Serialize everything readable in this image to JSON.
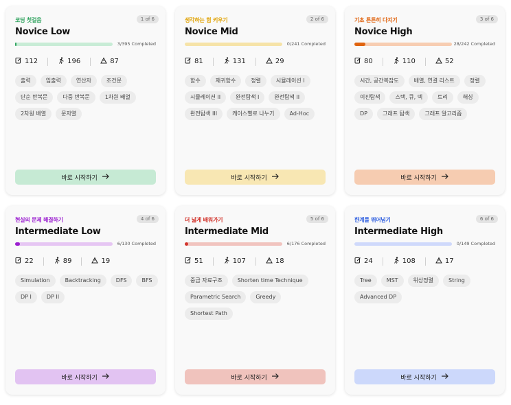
{
  "cards": [
    {
      "subtitle": "코딩 첫걸음",
      "subtitle_color": "#2fa25e",
      "stage": "1 of 6",
      "title": "Novice Low",
      "progress_text": "3/395 Completed",
      "progress_fraction": 0.0076,
      "track_color": "#c8ecd6",
      "fill_color": "#2fa25e",
      "stats": {
        "problems": "112",
        "solvers": "196",
        "levels": "87"
      },
      "tags": [
        "출력",
        "입출력",
        "연산자",
        "조건문",
        "단순 반복문",
        "다중 반복문",
        "1차원 배열",
        "2차원 배열",
        "문자열"
      ],
      "button_label": "바로 시작하기",
      "button_color": "#c6ead4"
    },
    {
      "subtitle": "생각하는 힘 키우기",
      "subtitle_color": "#e0a100",
      "stage": "2 of 6",
      "title": "Novice Mid",
      "progress_text": "0/241 Completed",
      "progress_fraction": 0,
      "track_color": "#f6e3a8",
      "fill_color": "#e0a100",
      "stats": {
        "problems": "81",
        "solvers": "131",
        "levels": "29"
      },
      "tags": [
        "함수",
        "재귀함수",
        "정렬",
        "시뮬레이션 I",
        "시뮬레이션 II",
        "완전탐색 I",
        "완전탐색 II",
        "완전탐색 III",
        "케이스별로 나누기",
        "Ad-Hoc"
      ],
      "button_label": "바로 시작하기",
      "button_color": "#f8e7b3"
    },
    {
      "subtitle": "기초 튼튼히 다지기",
      "subtitle_color": "#e06410",
      "stage": "3 of 6",
      "title": "Novice High",
      "progress_text": "28/242 Completed",
      "progress_fraction": 0.1157,
      "track_color": "#f7cdb2",
      "fill_color": "#e06410",
      "stats": {
        "problems": "80",
        "solvers": "110",
        "levels": "52"
      },
      "tags": [
        "시간, 공간복잡도",
        "배열, 연결 리스트",
        "정렬",
        "이진탐색",
        "스택, 큐, 덱",
        "트리",
        "해싱",
        "DP",
        "그래프 탐색",
        "그래프 알고리즘"
      ],
      "button_label": "바로 시작하기",
      "button_color": "#f6ccb1"
    },
    {
      "subtitle": "현실의 문제 해결하기",
      "subtitle_color": "#9b1fd0",
      "stage": "4 of 6",
      "title": "Intermediate Low",
      "progress_text": "6/130 Completed",
      "progress_fraction": 0.046,
      "track_color": "#e6c6f3",
      "fill_color": "#9b1fd0",
      "stats": {
        "problems": "22",
        "solvers": "89",
        "levels": "19"
      },
      "tags": [
        "Simulation",
        "Backtracking",
        "DFS",
        "BFS",
        "DP I",
        "DP II"
      ],
      "button_label": "바로 시작하기",
      "button_color": "#e2c3f2"
    },
    {
      "subtitle": "더 넓게 배워가기",
      "subtitle_color": "#d2342c",
      "stage": "5 of 6",
      "title": "Intermediate Mid",
      "progress_text": "6/176 Completed",
      "progress_fraction": 0.034,
      "track_color": "#f1c4bf",
      "fill_color": "#d2342c",
      "stats": {
        "problems": "51",
        "solvers": "107",
        "levels": "18"
      },
      "tags": [
        "중급 자료구조",
        "Shorten time Technique",
        "Parametric Search",
        "Greedy",
        "Shortest Path"
      ],
      "button_label": "바로 시작하기",
      "button_color": "#f0c3bd"
    },
    {
      "subtitle": "한계를 뛰어넘기",
      "subtitle_color": "#2f5fe0",
      "stage": "6 of 6",
      "title": "Intermediate High",
      "progress_text": "0/149 Completed",
      "progress_fraction": 0,
      "track_color": "#cfd9fb",
      "fill_color": "#2f5fe0",
      "stats": {
        "problems": "24",
        "solvers": "108",
        "levels": "17"
      },
      "tags": [
        "Tree",
        "MST",
        "위상정렬",
        "String",
        "Advanced DP"
      ],
      "button_label": "바로 시작하기",
      "button_color": "#ccd8fb"
    }
  ]
}
